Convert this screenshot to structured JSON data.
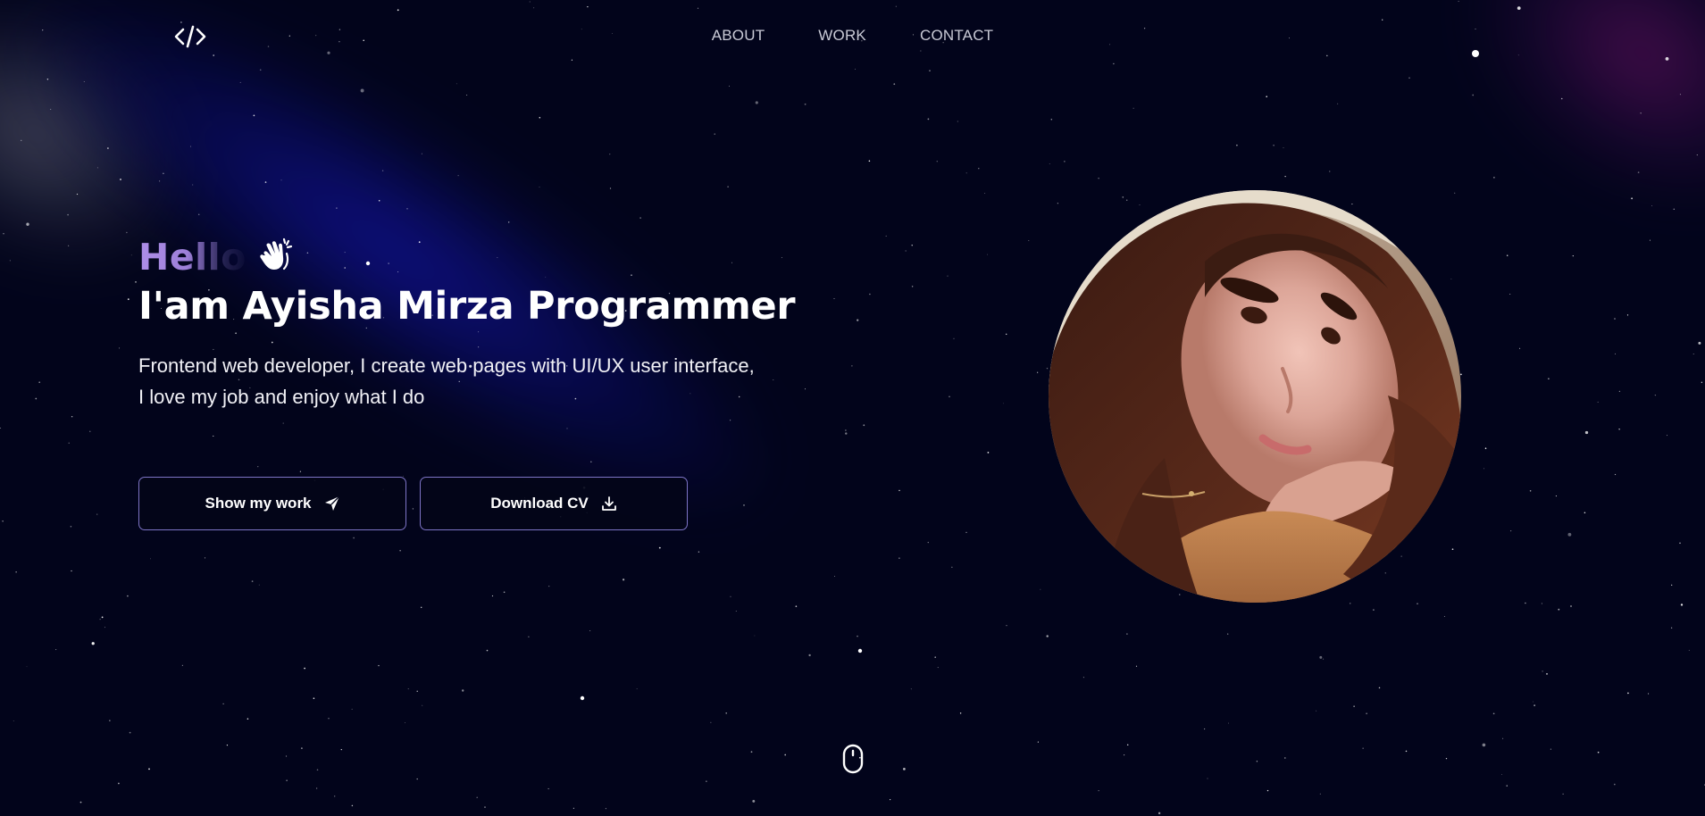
{
  "header": {
    "logo_icon": "code-brackets-icon",
    "nav": [
      {
        "label": "ABOUT"
      },
      {
        "label": "WORK"
      },
      {
        "label": "CONTACT"
      }
    ]
  },
  "hero": {
    "greeting": "Hello",
    "greeting_icon": "waving-hand-icon",
    "headline": "I'am Ayisha Mirza Programmer",
    "description_line1": "Frontend web developer, I create web pages with UI/UX user interface,",
    "description_line2": "I love my job and enjoy what I do",
    "buttons": {
      "show_work": {
        "label": "Show my work",
        "icon": "paper-plane-icon"
      },
      "download_cv": {
        "label": "Download CV",
        "icon": "download-icon"
      }
    },
    "portrait": "profile-photo"
  },
  "scroll": {
    "icon": "mouse-scroll-icon"
  },
  "colors": {
    "background": "#02041b",
    "accent_purple": "#ae8ee8",
    "button_border": "#7d74c6",
    "glow_blue": "#10129a",
    "glow_magenta": "#55105a"
  }
}
